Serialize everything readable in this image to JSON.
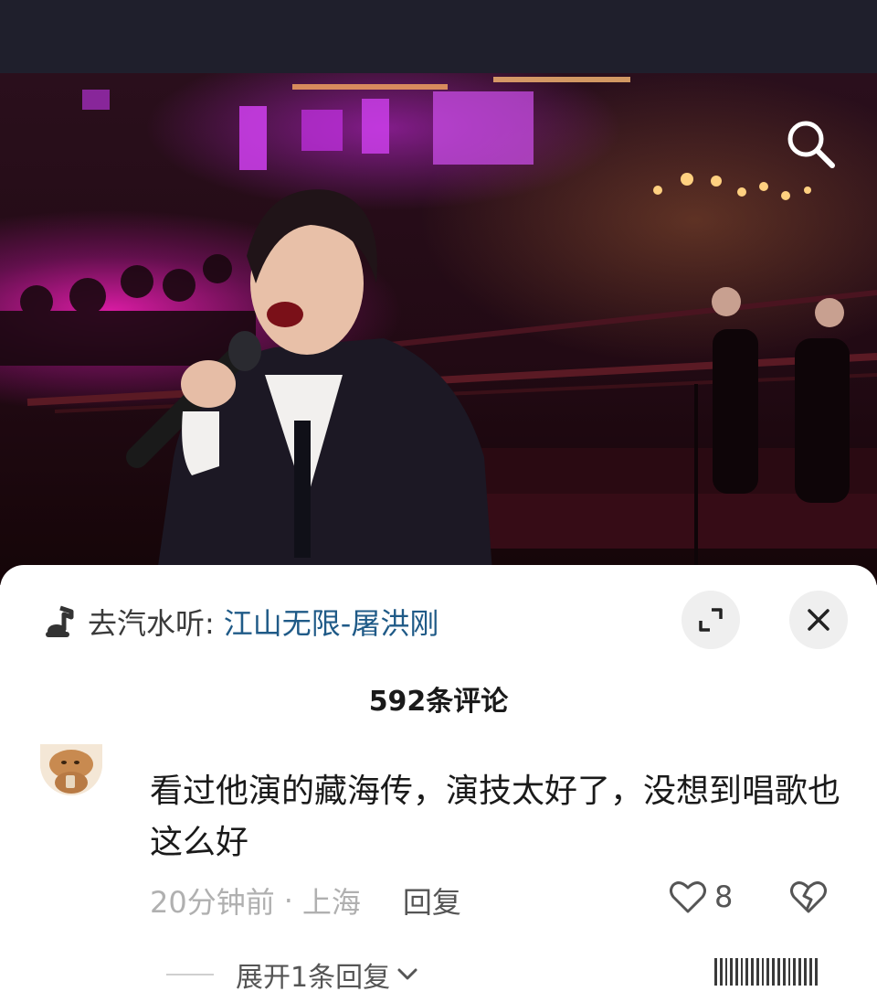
{
  "video": {
    "icons": {
      "search": "search-icon"
    }
  },
  "sheet": {
    "music": {
      "prefix": "去汽水听: ",
      "song": "江山无限-屠洪刚",
      "icon": "music-note-icon"
    },
    "buttons": {
      "expand": "expand-icon",
      "close": "close-icon"
    },
    "comment_count": "592条评论",
    "comment": {
      "text": "看过他演的藏海传，演技太好了，没想到唱歌也这么好",
      "time": "20分钟前",
      "separator": "·",
      "location": "上海",
      "reply_label": "回复",
      "likes": "8"
    },
    "expand_replies": "展开1条回复"
  },
  "colors": {
    "topbar": "#1f1f2c",
    "link": "#1f5a87",
    "meta": "#b0b0b0",
    "stage_pink": "#e21caa"
  }
}
